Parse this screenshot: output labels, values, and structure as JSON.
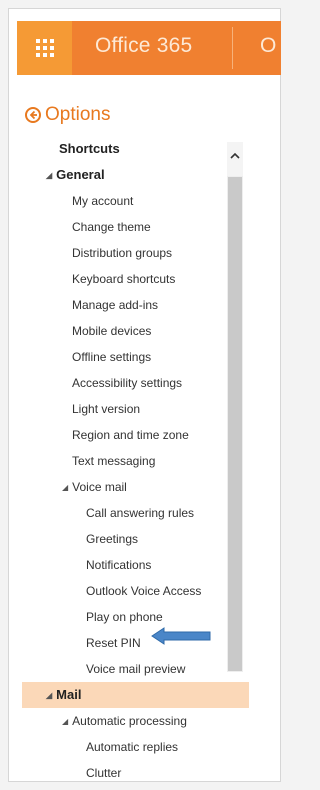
{
  "header": {
    "brand": "Office 365",
    "brand_partial": "O"
  },
  "options": {
    "title": "Options"
  },
  "nav": {
    "shortcuts": "Shortcuts",
    "general": "General",
    "general_items": [
      "My account",
      "Change theme",
      "Distribution groups",
      "Keyboard shortcuts",
      "Manage add-ins",
      "Mobile devices",
      "Offline settings",
      "Accessibility settings",
      "Light version",
      "Region and time zone",
      "Text messaging"
    ],
    "voice_mail": "Voice mail",
    "voice_mail_items": [
      "Call answering rules",
      "Greetings",
      "Notifications",
      "Outlook Voice Access",
      "Play on phone",
      "Reset PIN",
      "Voice mail preview"
    ],
    "mail": "Mail",
    "automatic_processing": "Automatic processing",
    "automatic_items": [
      "Automatic replies",
      "Clutter"
    ]
  },
  "colors": {
    "brand_orange": "#f08030",
    "accent_orange": "#e8791f",
    "highlight": "#fbd8b8",
    "arrow_blue": "#4a86c8"
  },
  "icons": {
    "app_launcher": "waffle-icon",
    "back": "back-circle-arrow-icon",
    "scroll_up": "chevron-up-icon",
    "pointer": "blue-arrow-icon"
  }
}
